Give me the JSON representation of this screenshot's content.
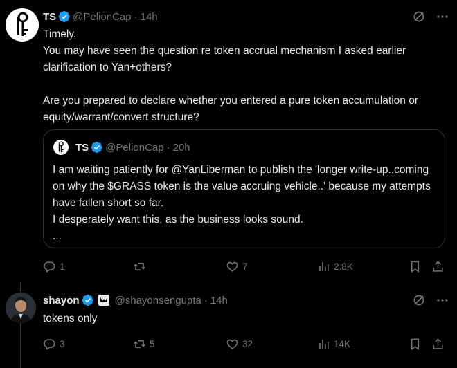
{
  "tweet1": {
    "name": "TS",
    "handle": "@PelionCap",
    "time": "14h",
    "text": "Timely.\nYou may have seen the question re token accrual mechanism I asked earlier clarification to Yan+others?\n\nAre you prepared to declare whether you entered a pure token accumulation or equity/warrant/convert structure?",
    "quote": {
      "name": "TS",
      "handle": "@PelionCap",
      "time": "20h",
      "text": "I am waiting patiently for @YanLiberman to publish the 'longer write-up..coming on why the $GRASS token is the value accruing vehicle..' because my attempts have fallen short so far.\nI desperately want this, as the business looks sound.\n..."
    },
    "actions": {
      "replies": "1",
      "reposts": "",
      "likes": "7",
      "views": "2.8K"
    }
  },
  "tweet2": {
    "name": "shayon",
    "handle": "@shayonsengupta",
    "time": "14h",
    "text": "tokens only",
    "actions": {
      "replies": "3",
      "reposts": "5",
      "likes": "32",
      "views": "14K"
    }
  },
  "dot": "·",
  "colors": {
    "verified": "#1d9bf0",
    "muted": "#71767b",
    "text": "#e7e9ea",
    "border": "#2f3336"
  },
  "icons": [
    "grok-icon",
    "more-icon",
    "reply-icon",
    "repost-icon",
    "like-icon",
    "views-icon",
    "bookmark-icon",
    "share-icon",
    "verified-badge-icon",
    "affiliate-badge-icon"
  ]
}
